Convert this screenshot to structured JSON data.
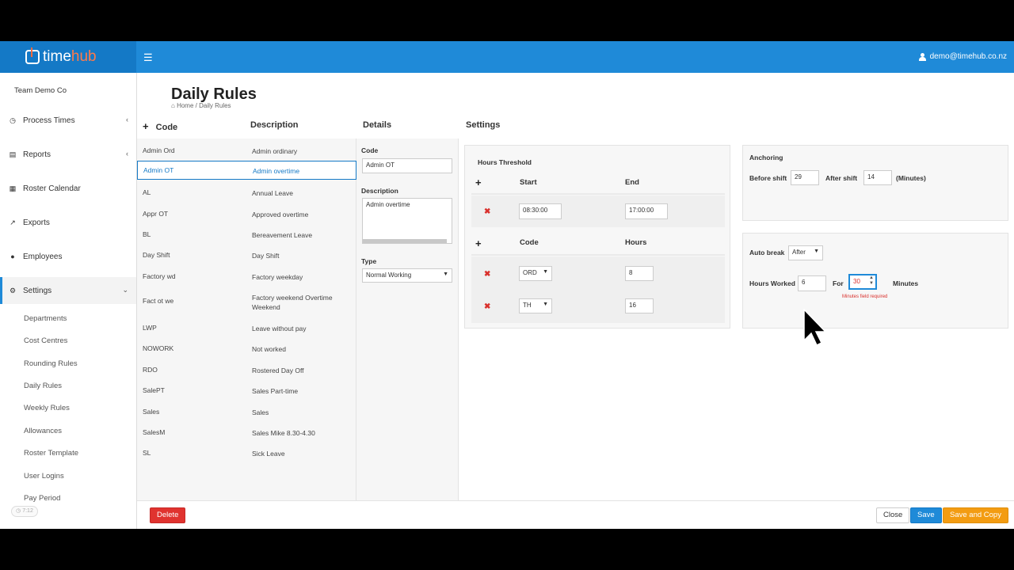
{
  "header": {
    "logo_prefix": "time",
    "logo_accent": "hub",
    "user_email": "demo@timehub.co.nz",
    "menu_icon": "hamburger-icon"
  },
  "sidebar": {
    "company": "Team Demo Co",
    "items": [
      {
        "label": "Process Times",
        "icon": "clock-icon"
      },
      {
        "label": "Reports",
        "icon": "report-icon"
      },
      {
        "label": "Roster Calendar",
        "icon": "calendar-icon"
      },
      {
        "label": "Exports",
        "icon": "export-icon"
      },
      {
        "label": "Employees",
        "icon": "users-icon"
      },
      {
        "label": "Settings",
        "icon": "cogs-icon"
      }
    ],
    "settings_sub": [
      "Departments",
      "Cost Centres",
      "Rounding Rules",
      "Daily Rules",
      "Weekly Rules",
      "Allowances",
      "Roster Template",
      "User Logins",
      "Pay Period"
    ],
    "timer_badge": "7:12"
  },
  "page": {
    "title": "Daily Rules",
    "breadcrumb": "Home / Daily Rules"
  },
  "columns": {
    "code": "Code",
    "description": "Description",
    "details": "Details",
    "settings": "Settings"
  },
  "rules": [
    {
      "code": "Admin Ord",
      "description": "Admin ordinary"
    },
    {
      "code": "Admin OT",
      "description": "Admin overtime"
    },
    {
      "code": "AL",
      "description": "Annual Leave"
    },
    {
      "code": "Appr OT",
      "description": "Approved overtime"
    },
    {
      "code": "BL",
      "description": "Bereavement Leave"
    },
    {
      "code": "Day Shift",
      "description": "Day Shift"
    },
    {
      "code": "Factory wd",
      "description": "Factory weekday"
    },
    {
      "code": "Fact ot we",
      "description": "Factory weekend Overtime Weekend"
    },
    {
      "code": "LWP",
      "description": "Leave without pay"
    },
    {
      "code": "NOWORK",
      "description": "Not worked"
    },
    {
      "code": "RDO",
      "description": "Rostered Day Off"
    },
    {
      "code": "SalePT",
      "description": "Sales Part-time"
    },
    {
      "code": "Sales",
      "description": "Sales"
    },
    {
      "code": "SalesM",
      "description": "Sales Mike 8.30-4.30"
    },
    {
      "code": "SL",
      "description": "Sick Leave"
    }
  ],
  "details": {
    "code_label": "Code",
    "code_value": "Admin OT",
    "description_label": "Description",
    "description_value": "Admin overtime",
    "type_label": "Type",
    "type_value": "Normal Working"
  },
  "threshold": {
    "title": "Hours Threshold",
    "start_header": "Start",
    "end_header": "End",
    "start": "08:30:00",
    "end": "17:00:00",
    "code_header": "Code",
    "hours_header": "Hours",
    "rows": [
      {
        "code": "ORD",
        "hours": "8"
      },
      {
        "code": "TH",
        "hours": "16"
      }
    ]
  },
  "anchoring": {
    "title": "Anchoring",
    "before_label": "Before shift",
    "before_value": "29",
    "after_label": "After shift",
    "after_value": "14",
    "unit": "(Minutes)"
  },
  "autobreak": {
    "label": "Auto break",
    "mode": "After",
    "hours_worked_label": "Hours Worked",
    "hours_worked_value": "6",
    "for_label": "For",
    "for_value": "30",
    "minutes_label": "Minutes",
    "error": "Minutes field required"
  },
  "footer": {
    "delete": "Delete",
    "close": "Close",
    "save": "Save",
    "save_copy": "Save and Copy"
  },
  "colors": {
    "brand": "#1f8ad8",
    "danger": "#e0332f",
    "warning": "#f39c12"
  }
}
